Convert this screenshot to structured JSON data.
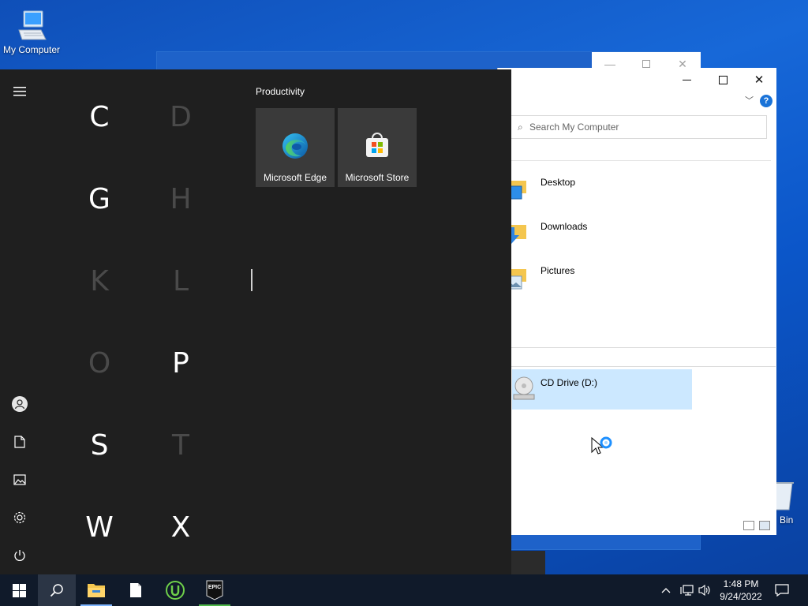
{
  "desktop": {
    "my_computer_label": "My Computer",
    "recycle_bin_label": "Bin"
  },
  "explorer": {
    "search_placeholder": "Search My Computer",
    "help_glyph": "?",
    "folders": [
      {
        "label": "Desktop",
        "icon": "desktop-folder-icon"
      },
      {
        "label": "Downloads",
        "icon": "downloads-folder-icon"
      },
      {
        "label": "Pictures",
        "icon": "pictures-folder-icon"
      }
    ],
    "drive_label": "CD Drive (D:)"
  },
  "start_menu": {
    "letters": [
      {
        "char": "C",
        "enabled": true
      },
      {
        "char": "D",
        "enabled": false
      },
      {
        "char": "G",
        "enabled": true
      },
      {
        "char": "H",
        "enabled": false
      },
      {
        "char": "K",
        "enabled": false
      },
      {
        "char": "L",
        "enabled": false
      },
      {
        "char": "O",
        "enabled": false
      },
      {
        "char": "P",
        "enabled": true
      },
      {
        "char": "S",
        "enabled": true
      },
      {
        "char": "T",
        "enabled": false
      },
      {
        "char": "W",
        "enabled": true
      },
      {
        "char": "X",
        "enabled": true
      }
    ],
    "group_title": "Productivity",
    "tiles": [
      {
        "label": "Microsoft Edge",
        "icon": "edge-icon"
      },
      {
        "label": "Microsoft Store",
        "icon": "store-icon"
      }
    ],
    "rail": [
      "hamburger-icon",
      "user-icon",
      "documents-icon",
      "pictures-icon",
      "settings-icon",
      "power-icon"
    ]
  },
  "taskbar": {
    "apps": [
      "start-icon",
      "search-icon",
      "file-explorer-icon",
      "notepad-icon",
      "utorrent-icon",
      "epic-games-icon"
    ],
    "epic_text": "EPIC",
    "clock": {
      "time": "1:48 PM",
      "date": "9/24/2022"
    },
    "colors": {
      "taskbar_bg": "#101a2a",
      "accent": "#0078d7",
      "start_bg": "#1f1f1f",
      "selected_drive": "#cce8ff"
    }
  }
}
